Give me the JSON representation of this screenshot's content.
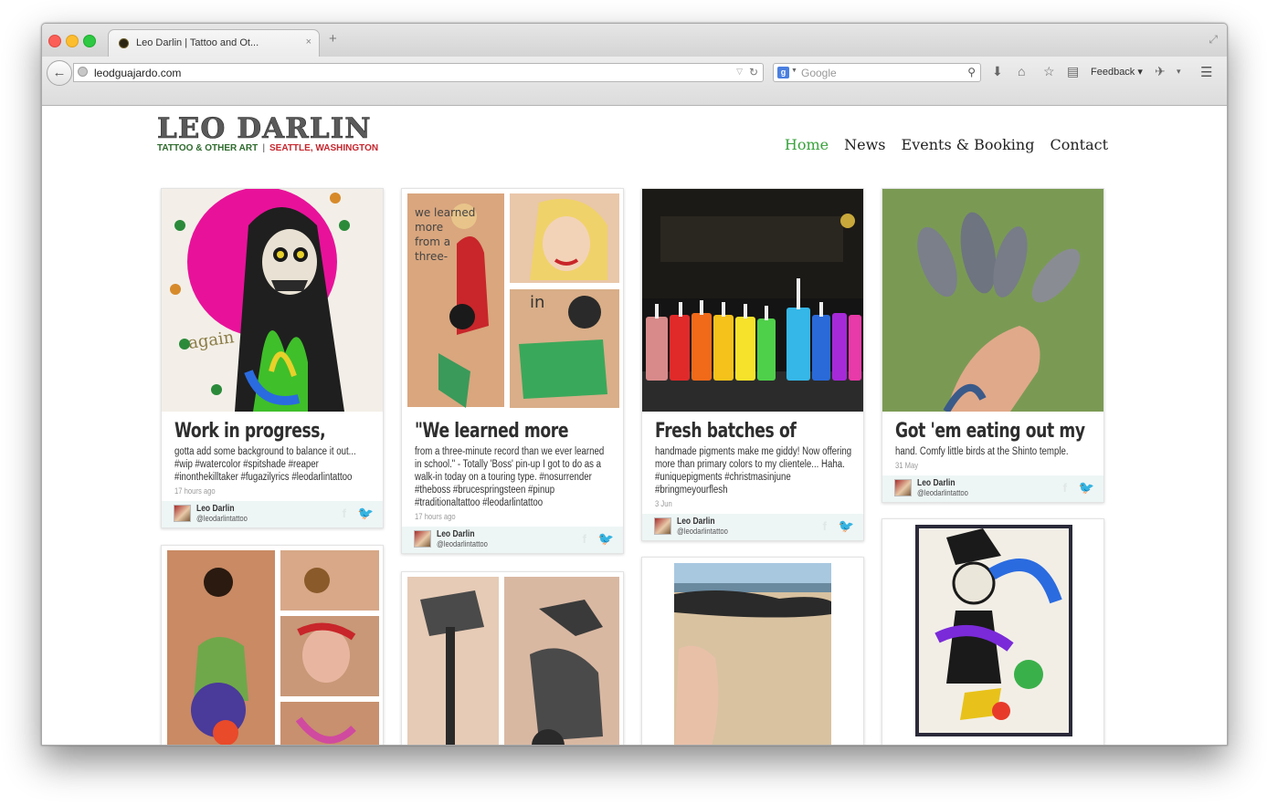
{
  "browser": {
    "tab_title": "Leo Darlin | Tattoo and Ot...",
    "tab_close": "×",
    "new_tab": "+",
    "url": "leodguajardo.com",
    "search_placeholder": "Google",
    "feedback_label": "Feedback ▾"
  },
  "site": {
    "logo_main": "LEO DARLIN",
    "logo_sub_left": "TATTOO & OTHER ART",
    "logo_sub_sep": "|",
    "logo_sub_right": "SEATTLE, WASHINGTON",
    "nav": [
      {
        "label": "Home"
      },
      {
        "label": "News"
      },
      {
        "label": "Events & Booking"
      },
      {
        "label": "Contact"
      }
    ]
  },
  "posts": [
    {
      "title": "Work in progress,",
      "text": "gotta add some background to balance it out... #wip #watercolor #spitshade #reaper #inonthekilltaker #fugazilyrics #leodarlintattoo",
      "time": "17 hours ago",
      "author": "Leo Darlin",
      "handle": "@leodarlintattoo"
    },
    {
      "title": "\"We learned more",
      "text": "from a three-minute record than we ever learned in school.\" - Totally 'Boss' pin-up I got to do as a walk-in today on a touring type. #nosurrender #theboss #brucespringsteen #pinup #traditionaltattoo #leodarlintattoo",
      "time": "17 hours ago",
      "author": "Leo Darlin",
      "handle": "@leodarlintattoo"
    },
    {
      "title": "Fresh batches of",
      "text": "handmade pigments make me giddy! Now offering more than primary colors to my clientele... Haha. #uniquepigments #christmasinjune #bringmeyourflesh",
      "time": "3 Jun",
      "author": "Leo Darlin",
      "handle": "@leodarlintattoo"
    },
    {
      "title": "Got 'em eating out my",
      "text": "hand. Comfy little birds at the Shinto temple.",
      "time": "31 May",
      "author": "Leo Darlin",
      "handle": "@leodarlintattoo"
    }
  ],
  "colors": {
    "nav_active": "#37a23b",
    "logo_green": "#2d6a2c",
    "logo_red": "#c6262e",
    "card_footer": "#eef5f5"
  }
}
